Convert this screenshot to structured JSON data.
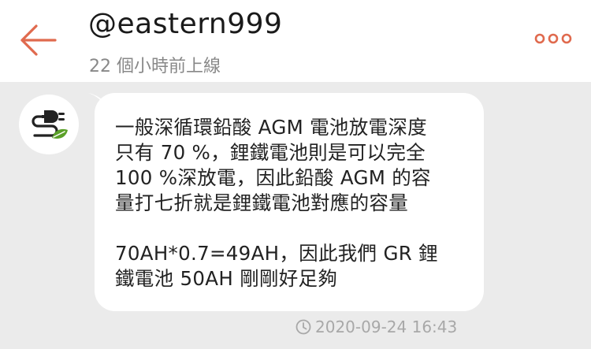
{
  "colors": {
    "accent": "#e06a4e",
    "background": "#ebebeb",
    "header_bg": "#ffffff",
    "bubble_bg": "#ffffff",
    "text": "#222222",
    "muted": "#888888",
    "avatar_icon": "#222222",
    "leaf": "#5aa028"
  },
  "header": {
    "back_icon": "arrow-left-icon",
    "title": "@eastern999",
    "status": "22 個小時前上線",
    "more_icon": "three-dots-icon"
  },
  "conversation": {
    "avatar_icon": "plug-leaf-icon",
    "message": {
      "lines": [
        "一般深循環鉛酸 AGM 電池放電深度",
        "只有 70 %，鋰鐵電池則是可以完全",
        "100 %深放電，因此鉛酸 AGM 的容",
        "量打七折就是鋰鐵電池對應的容量",
        "",
        "70AH*0.7=49AH，因此我們 GR 鋰",
        "鐵電池 50AH 剛剛好足夠"
      ],
      "timestamp_icon": "clock-icon",
      "timestamp": "2020-09-24 16:43"
    }
  }
}
